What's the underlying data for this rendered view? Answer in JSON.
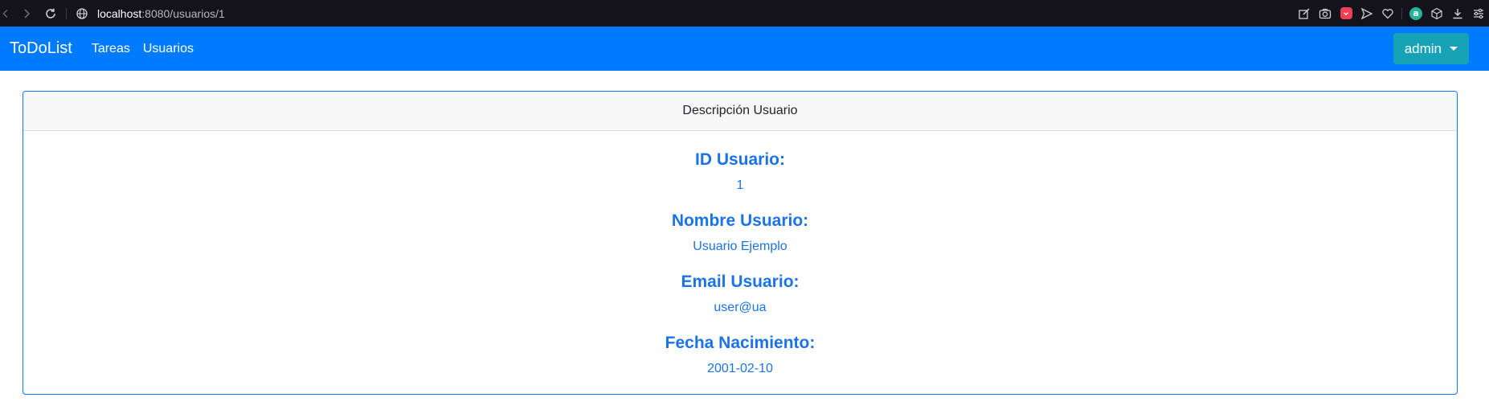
{
  "browser": {
    "url_host": "localhost",
    "url_rest": ":8080/usuarios/1"
  },
  "navbar": {
    "brand": "ToDoList",
    "links": [
      "Tareas",
      "Usuarios"
    ],
    "user_button": "admin"
  },
  "card": {
    "header": "Descripción Usuario",
    "fields": [
      {
        "label": "ID Usuario:",
        "value": "1"
      },
      {
        "label": "Nombre Usuario:",
        "value": "Usuario Ejemplo"
      },
      {
        "label": "Email Usuario:",
        "value": "user@ua"
      },
      {
        "label": "Fecha Nacimiento:",
        "value": "2001-02-10"
      }
    ]
  },
  "colors": {
    "navbar": "#007bff",
    "user_button": "#17a2b8",
    "field_text": "#1b73e8",
    "browser_bar": "#14131c"
  }
}
